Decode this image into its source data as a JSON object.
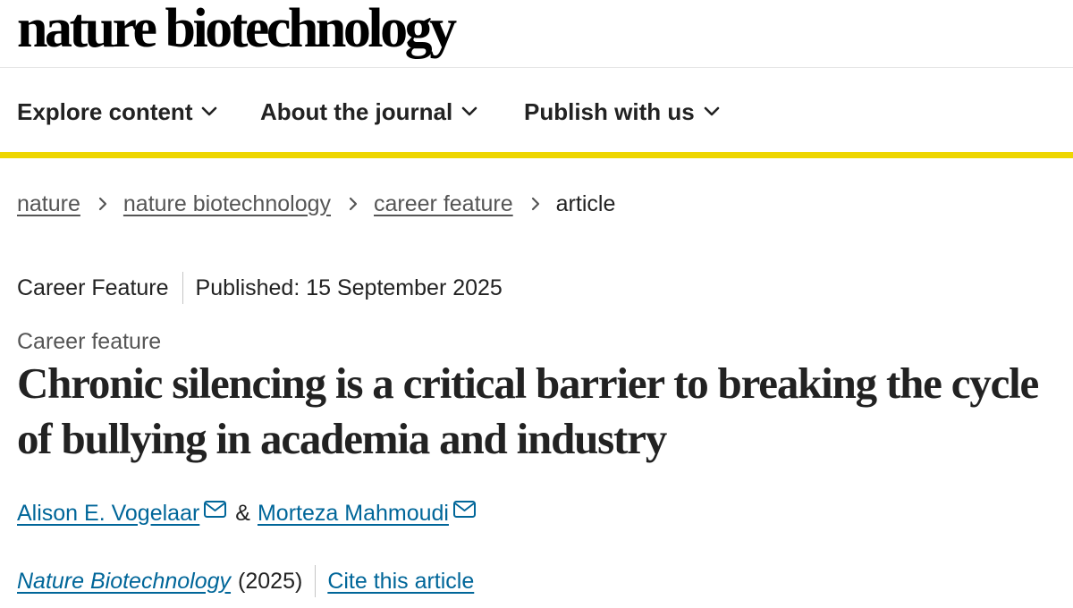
{
  "header": {
    "brand": "nature biotechnology"
  },
  "nav": {
    "items": [
      {
        "label": "Explore content"
      },
      {
        "label": "About the journal"
      },
      {
        "label": "Publish with us"
      }
    ]
  },
  "breadcrumb": {
    "items": [
      "nature",
      "nature biotechnology",
      "career feature"
    ],
    "current": "article"
  },
  "article": {
    "type": "Career Feature",
    "published": "Published: 15 September 2025",
    "kicker": "Career feature",
    "title": "Chronic silencing is a critical barrier to breaking the cycle of bullying in academia and industry",
    "authors": [
      "Alison E. Vogelaar",
      "Morteza Mahmoudi"
    ],
    "author_separator": "&",
    "journal": "Nature Biotechnology",
    "year": "(2025)",
    "cite_label": "Cite this article"
  },
  "colors": {
    "accent_bar": "#eed600",
    "link": "#006699",
    "text": "#222222"
  },
  "icons": [
    "chevron-down-icon",
    "chevron-right-icon",
    "envelope-icon"
  ]
}
